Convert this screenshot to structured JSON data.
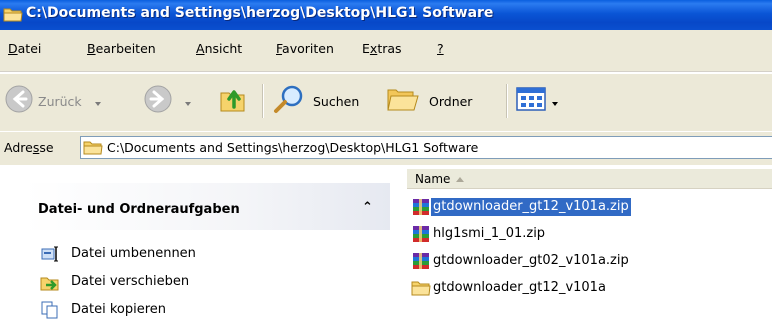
{
  "window": {
    "title": "C:\\Documents and Settings\\herzog\\Desktop\\HLG1 Software"
  },
  "menubar": {
    "items": [
      {
        "pre": "",
        "key": "D",
        "post": "atei"
      },
      {
        "pre": "",
        "key": "B",
        "post": "earbeiten"
      },
      {
        "pre": "",
        "key": "A",
        "post": "nsicht"
      },
      {
        "pre": "",
        "key": "F",
        "post": "avoriten"
      },
      {
        "pre": "E",
        "key": "x",
        "post": "tras"
      },
      {
        "pre": "",
        "key": "?",
        "post": ""
      }
    ]
  },
  "toolbar": {
    "back_label": "Zurück",
    "search_label": "Suchen",
    "folders_label": "Ordner"
  },
  "address": {
    "label_pre": "Adre",
    "label_key": "s",
    "label_post": "se",
    "value": "C:\\Documents and Settings\\herzog\\Desktop\\HLG1 Software"
  },
  "taskpane": {
    "title": "Datei- und Ordneraufgaben",
    "collapse_glyph": "⌃",
    "tasks": [
      {
        "label": "Datei umbenennen",
        "icon": "rename-icon"
      },
      {
        "label": "Datei verschieben",
        "icon": "move-icon"
      },
      {
        "label": "Datei kopieren",
        "icon": "copy-icon"
      }
    ]
  },
  "filelist": {
    "column_name": "Name",
    "files": [
      {
        "name": "gtdownloader_gt12_v101a.zip",
        "type": "winrar-archive-icon",
        "selected": true
      },
      {
        "name": "hlg1smi_1_01.zip",
        "type": "winrar-archive-icon",
        "selected": false
      },
      {
        "name": "gtdownloader_gt02_v101a.zip",
        "type": "winrar-archive-icon",
        "selected": false
      },
      {
        "name": "gtdownloader_gt12_v101a",
        "type": "folder-icon",
        "selected": false
      }
    ]
  },
  "colors": {
    "titlebar": "#0a55d6",
    "selection": "#316ac5",
    "chrome": "#ece9d8"
  }
}
